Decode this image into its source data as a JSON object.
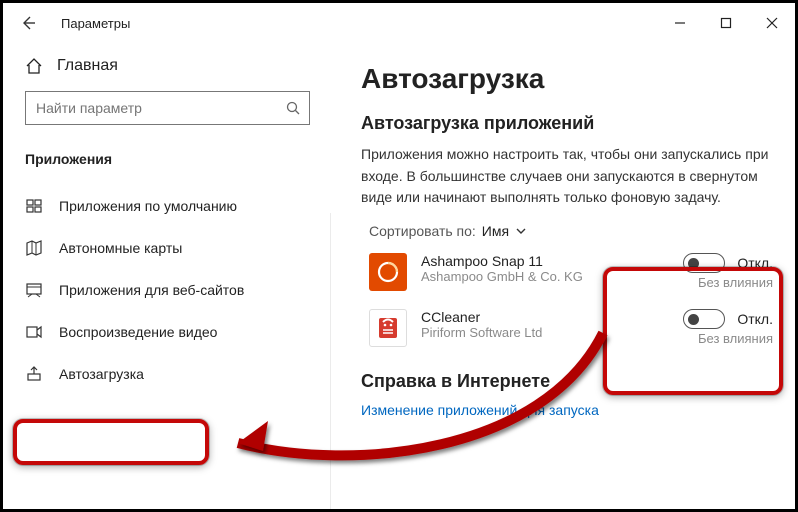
{
  "window": {
    "title": "Параметры"
  },
  "sidebar": {
    "home_label": "Главная",
    "search_placeholder": "Найти параметр",
    "section_label": "Приложения",
    "items": [
      {
        "label": "Приложения по умолчанию",
        "icon": "default-apps-icon"
      },
      {
        "label": "Автономные карты",
        "icon": "maps-icon"
      },
      {
        "label": "Приложения для веб-сайтов",
        "icon": "web-apps-icon"
      },
      {
        "label": "Воспроизведение видео",
        "icon": "video-icon"
      },
      {
        "label": "Автозагрузка",
        "icon": "startup-icon"
      }
    ]
  },
  "content": {
    "page_title": "Автозагрузка",
    "sub_title": "Автозагрузка приложений",
    "description": "Приложения можно настроить так, чтобы они запускались при входе. В большинстве случаев они запускаются в свернутом виде или начинают выполнять только фоновую задачу.",
    "sort_label": "Сортировать по:",
    "sort_value": "Имя",
    "apps": [
      {
        "name": "Ashampoo Snap 11",
        "publisher": "Ashampoo GmbH & Co. KG",
        "state_label": "Откл.",
        "impact": "Без влияния",
        "icon_color": "#e24a00"
      },
      {
        "name": "CCleaner",
        "publisher": "Piriform Software Ltd",
        "state_label": "Откл.",
        "impact": "Без влияния",
        "icon_color": "#d63b2e"
      }
    ],
    "help_title": "Справка в Интернете",
    "help_link": "Изменение приложений для запуска"
  },
  "annotation": {
    "arrow_from": "toggle-highlight",
    "arrow_to": "sidebar-startup-highlight"
  }
}
